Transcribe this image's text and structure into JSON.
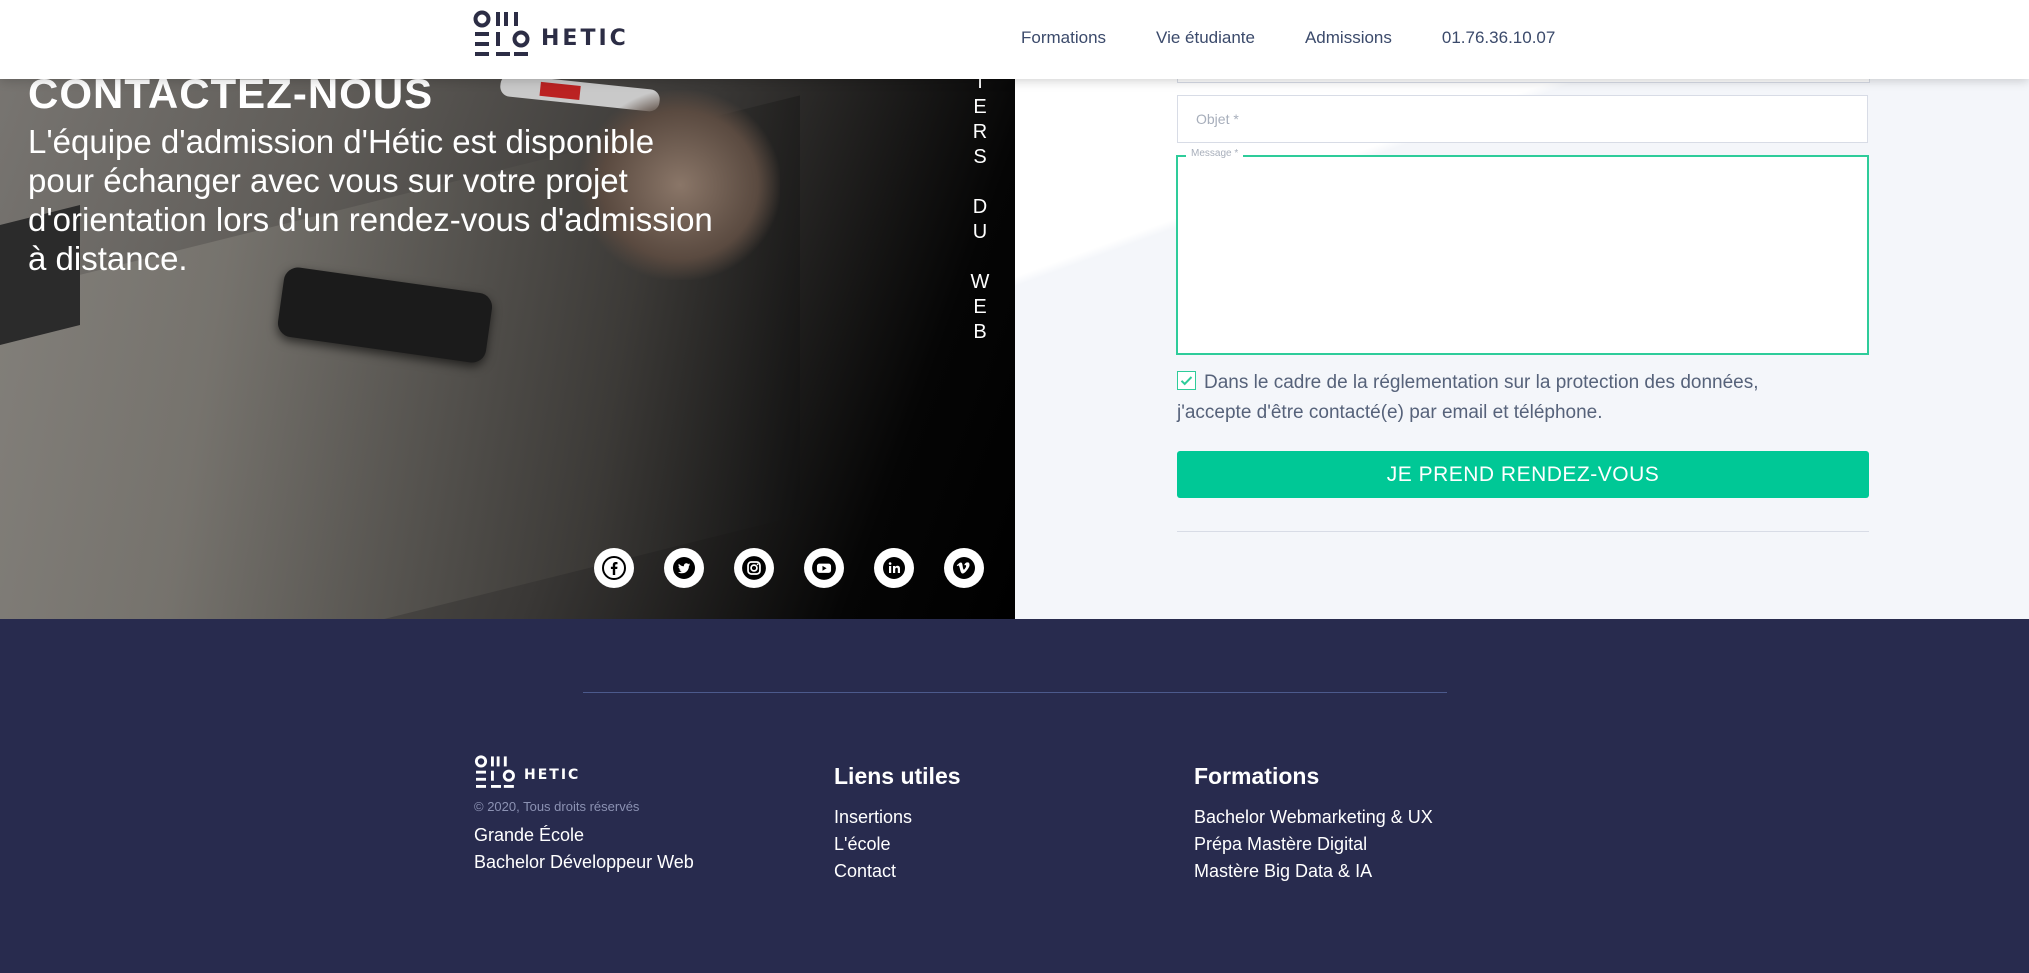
{
  "header": {
    "logo_text": "HETIC",
    "nav": [
      "Formations",
      "Vie étudiante",
      "Admissions",
      "01.76.36.10.07"
    ]
  },
  "hero": {
    "title": "CONTACTEZ-NOUS",
    "text": "L'équipe d'admission d'Hétic est disponible pour échanger avec vous sur votre projet d'orientation lors d'un rendez-vous d'admission à distance.",
    "vertical_letters": [
      "I",
      "E",
      "R",
      "S",
      "",
      "D",
      "U",
      "",
      "W",
      "E",
      "B"
    ],
    "socials": [
      "facebook-icon",
      "twitter-icon",
      "instagram-icon",
      "youtube-icon",
      "linkedin-icon",
      "vimeo-icon"
    ]
  },
  "form": {
    "objet_placeholder": "Objet *",
    "message_label": "Message *",
    "consent_text": "Dans le cadre de la réglementation sur la protection des données, j'accepte d'être contacté(e) par email et téléphone.",
    "consent_checked": true,
    "submit_label": "JE PREND RENDEZ-VOUS"
  },
  "footer": {
    "logo_text": "HETIC",
    "copyright": "© 2020, Tous droits réservés",
    "col1_links": [
      "Grande École",
      "Bachelor Développeur Web"
    ],
    "col2_title": "Liens utiles",
    "col2_links": [
      "Insertions",
      "L'école",
      "Contact"
    ],
    "col3_title": "Formations",
    "col3_links": [
      "Bachelor Webmarketing & UX",
      "Prépa Mastère Digital",
      "Mastère Big Data & IA"
    ]
  },
  "colors": {
    "accent": "#00c896",
    "footer_bg": "#282b4e",
    "text_dark": "#2c2d45"
  }
}
